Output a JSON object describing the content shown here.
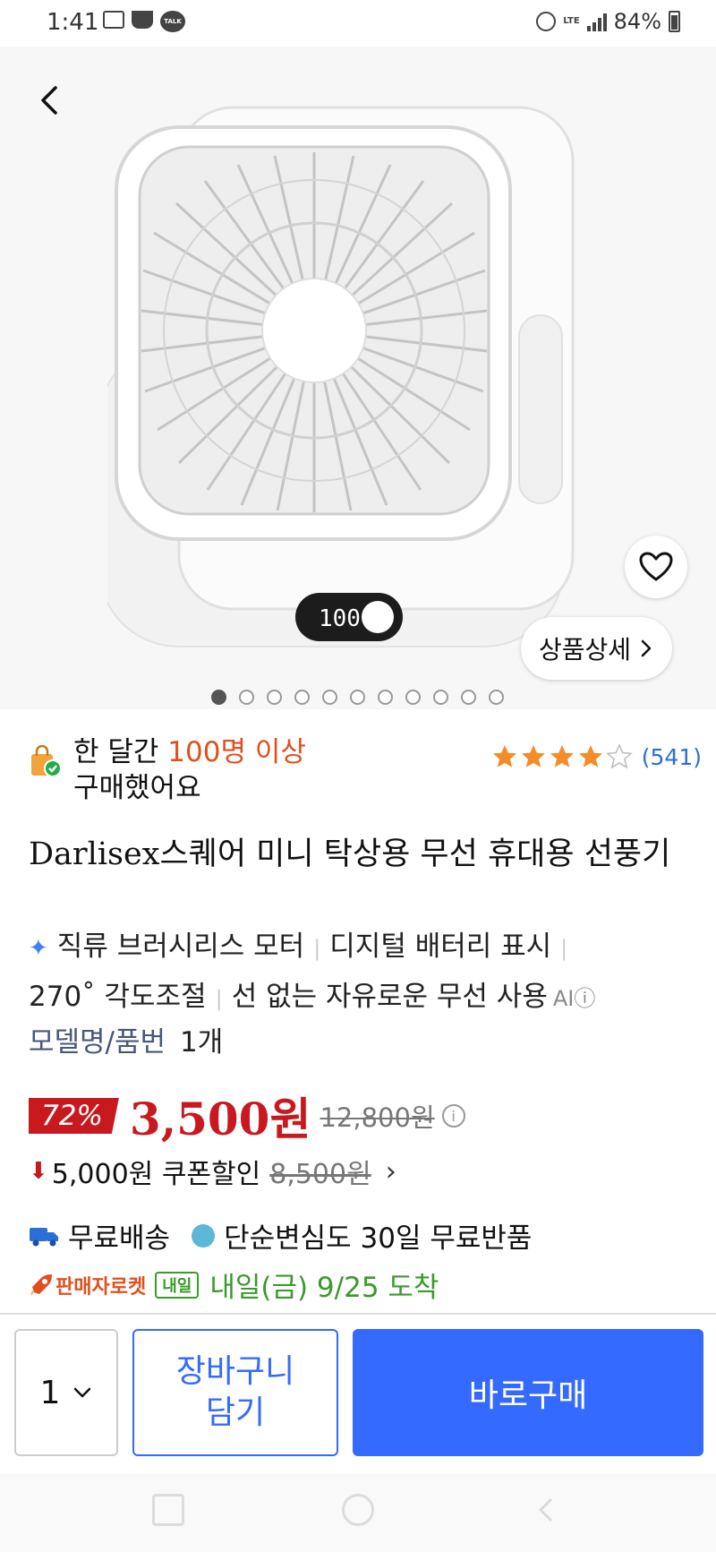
{
  "status_bar": {
    "time": "1:41",
    "battery": "84%",
    "talk_icon_text": "TALK",
    "lte_text": "LTE"
  },
  "hero": {
    "display_text": "100",
    "detail_button_label": "상품상세",
    "carousel_count": 11,
    "carousel_active_index": 0
  },
  "social_proof": {
    "prefix": "한 달간 ",
    "highlight": "100명 이상",
    "suffix": "구매했어요"
  },
  "rating": {
    "stars": 4,
    "max": 5,
    "count": "(541)"
  },
  "product": {
    "title": "Darlisex스퀘어 미니 탁상용 무선 휴대용 선풍기",
    "features": [
      "직류 브러시리스 모터",
      "디지털 배터리 표시",
      "270˚ 각도조절",
      "선 없는 자유로운 무선 사용"
    ],
    "ai_label": "AI",
    "model_label": "모델명/품번",
    "model_value": "1개"
  },
  "price": {
    "discount": "72%",
    "sale": "3,500원",
    "original": "12,800원",
    "coupon_text": "5,000원 쿠폰할인",
    "coupon_after": "8,500원"
  },
  "shipping": {
    "free_shipping": "무료배송",
    "free_return": "단순변심도 30일 무료반품",
    "seller_label": "판매자로켓",
    "tomorrow_badge": "내일",
    "eta": "내일(금) 9/25 도착"
  },
  "actions": {
    "quantity": "1",
    "cart_line1": "장바구니",
    "cart_line2": "담기",
    "buy_now": "바로구매"
  },
  "colors": {
    "accent_blue": "#346aff",
    "sale_red": "#c8191f",
    "highlight_orange": "#e0501f",
    "eta_green": "#3a9a2a",
    "star": "#f58c2a"
  },
  "icons": {
    "back": "chevron-left-icon",
    "wishlist": "heart-icon",
    "detail": "chevron-right-icon",
    "bag": "shopping-bag-icon",
    "sparkle": "sparkle-icon",
    "truck": "truck-icon",
    "return": "return-icon",
    "rocket": "rocket-icon",
    "qty": "chevron-down-icon"
  }
}
